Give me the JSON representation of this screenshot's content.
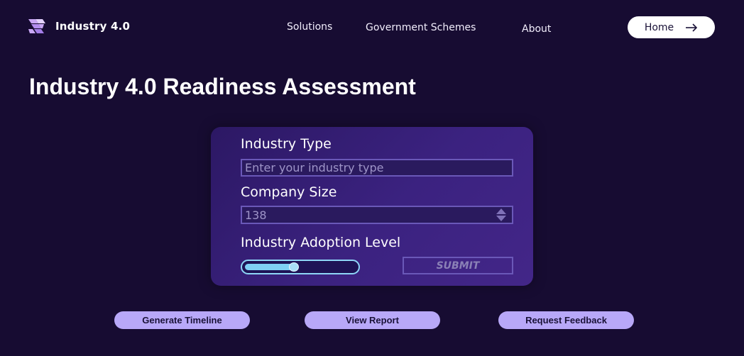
{
  "header": {
    "logo_text": "Industry 4.0",
    "nav": [
      {
        "label": "Solutions"
      },
      {
        "label": "Government Schemes"
      },
      {
        "label": "About"
      }
    ],
    "home_button": "Home"
  },
  "main": {
    "title": "Industry 4.0 Readiness Assessment"
  },
  "form": {
    "industry_type": {
      "label": "Industry Type",
      "placeholder": "Enter your industry type",
      "value": ""
    },
    "company_size": {
      "label": "Company Size",
      "value": "138"
    },
    "adoption_level": {
      "label": "Industry Adoption Level",
      "level_fraction": 0.45
    },
    "submit_label": "SUBMIT"
  },
  "actions": [
    {
      "label": "Generate Timeline"
    },
    {
      "label": "View Report"
    },
    {
      "label": "Request Feedback"
    }
  ],
  "colors": {
    "background": "#170c32",
    "card": "#3b2280",
    "accent": "#b8a8f8",
    "slider": "#7fd0f5",
    "logo": "#c9a8f5"
  }
}
